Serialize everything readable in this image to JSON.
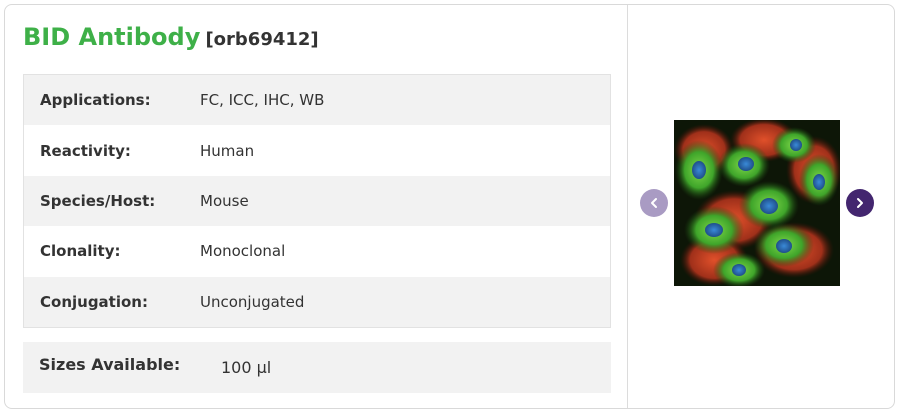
{
  "product": {
    "name": "BID Antibody",
    "sku": "[orb69412]"
  },
  "specs": [
    {
      "label": "Applications:",
      "value": "FC,  ICC,  IHC,  WB"
    },
    {
      "label": "Reactivity:",
      "value": "Human"
    },
    {
      "label": "Species/Host:",
      "value": "Mouse"
    },
    {
      "label": "Clonality:",
      "value": "Monoclonal"
    },
    {
      "label": "Conjugation:",
      "value": "Unconjugated"
    }
  ],
  "sizes": {
    "label": "Sizes Available:",
    "value": "100 µl"
  },
  "carousel": {
    "prev_icon": "chevron-left-icon",
    "next_icon": "chevron-right-icon"
  },
  "colors": {
    "title_green": "#3eb048",
    "row_alt": "#f2f2f2",
    "nav_prev": "#a99bc3",
    "nav_next": "#43266f"
  }
}
